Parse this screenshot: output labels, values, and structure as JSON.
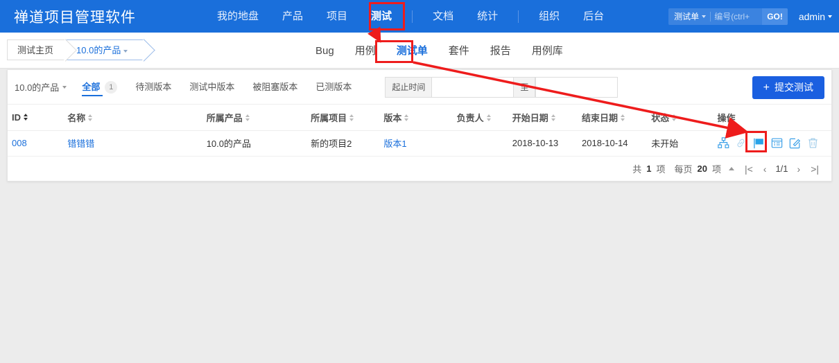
{
  "header": {
    "brand": "禅道项目管理软件",
    "nav": [
      {
        "label": "我的地盘",
        "active": false
      },
      {
        "label": "产品",
        "active": false
      },
      {
        "label": "项目",
        "active": false
      },
      {
        "label": "测试",
        "active": true
      },
      {
        "label": "文档",
        "active": false
      },
      {
        "label": "统计",
        "active": false
      },
      {
        "label": "组织",
        "active": false
      },
      {
        "label": "后台",
        "active": false
      }
    ],
    "search": {
      "type_label": "测试单",
      "placeholder": "编号(ctrl+",
      "go_label": "GO!"
    },
    "user": "admin"
  },
  "breadcrumb": {
    "items": [
      {
        "label": "测试主页",
        "active": false,
        "caret": false
      },
      {
        "label": "10.0的产品",
        "active": true,
        "caret": true
      }
    ]
  },
  "subnav": {
    "tabs": [
      {
        "label": "Bug",
        "active": false
      },
      {
        "label": "用例",
        "active": false
      },
      {
        "label": "测试单",
        "active": true
      },
      {
        "label": "套件",
        "active": false
      },
      {
        "label": "报告",
        "active": false
      },
      {
        "label": "用例库",
        "active": false
      }
    ]
  },
  "filterbar": {
    "product_selector": "10.0的产品",
    "tabs": [
      {
        "label": "全部",
        "badge": "1",
        "active": true
      },
      {
        "label": "待测版本",
        "badge": "",
        "active": false
      },
      {
        "label": "测试中版本",
        "badge": "",
        "active": false
      },
      {
        "label": "被阻塞版本",
        "badge": "",
        "active": false
      },
      {
        "label": "已测版本",
        "badge": "",
        "active": false
      }
    ],
    "date_label": "起止时间",
    "date_from": "",
    "date_to": "",
    "date_separator": "至",
    "submit_label": "提交测试",
    "submit_plus": "+"
  },
  "table": {
    "columns": [
      {
        "label": "ID",
        "sortable": true,
        "sorted": true
      },
      {
        "label": "名称",
        "sortable": true,
        "sorted": false
      },
      {
        "label": "所属产品",
        "sortable": true,
        "sorted": false
      },
      {
        "label": "所属项目",
        "sortable": true,
        "sorted": false
      },
      {
        "label": "版本",
        "sortable": true,
        "sorted": false
      },
      {
        "label": "负责人",
        "sortable": true,
        "sorted": false
      },
      {
        "label": "开始日期",
        "sortable": true,
        "sorted": false
      },
      {
        "label": "结束日期",
        "sortable": true,
        "sorted": false
      },
      {
        "label": "状态",
        "sortable": true,
        "sorted": false
      },
      {
        "label": "操作",
        "sortable": false,
        "sorted": false
      }
    ],
    "rows": [
      {
        "id": "008",
        "name": "错错错",
        "product": "10.0的产品",
        "project": "新的项目2",
        "version": "版本1",
        "owner": "",
        "begin": "2018-10-13",
        "end": "2018-10-14",
        "status": "未开始",
        "actions": [
          "sitemap-icon",
          "link-icon",
          "flag-icon",
          "detail-icon",
          "edit-icon",
          "delete-icon"
        ]
      }
    ]
  },
  "pager": {
    "total_prefix": "共",
    "total_count": "1",
    "total_suffix": "项",
    "perpage_prefix": "每页",
    "perpage_count": "20",
    "perpage_suffix": "项",
    "first": "|<",
    "prev": "‹",
    "page_info": "1/1",
    "next": "›",
    "last": ">|"
  },
  "annotations": {
    "color": "#ee1c1c",
    "boxes": [
      "测试",
      "测试单",
      "flag-icon"
    ]
  }
}
